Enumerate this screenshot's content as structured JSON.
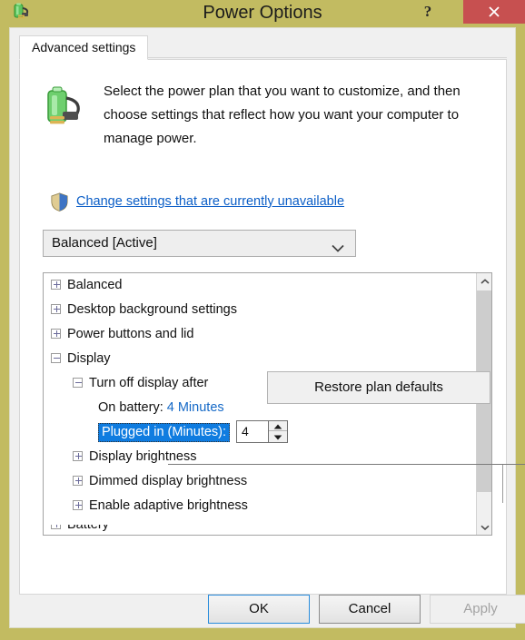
{
  "window": {
    "title": "Power Options",
    "icon": "power-plug-battery-icon",
    "titlebar_color": "#c2bb61",
    "close_color": "#c75050",
    "help_label": "?",
    "close_label": "✕"
  },
  "tabs": [
    {
      "label": "Advanced settings",
      "selected": true
    }
  ],
  "intro": {
    "text": "Select the power plan that you want to customize, and then choose settings that reflect how you want your computer to manage power.",
    "icon": "power-plug-battery-icon"
  },
  "change_link": {
    "label": "Change settings that are currently unavailable",
    "icon": "uac-shield-icon",
    "color": "#0b5ec7"
  },
  "plan_select": {
    "value": "Balanced [Active]",
    "arrow_icon": "chevron-down-icon"
  },
  "tree": {
    "nodes": [
      {
        "label": "Balanced",
        "indent": 0,
        "state": "collapsed"
      },
      {
        "label": "Desktop background settings",
        "indent": 0,
        "state": "collapsed"
      },
      {
        "label": "Power buttons and lid",
        "indent": 0,
        "state": "collapsed"
      },
      {
        "label": "Display",
        "indent": 0,
        "state": "expanded"
      },
      {
        "label": "Turn off display after",
        "indent": 1,
        "state": "expanded"
      },
      {
        "label": "On battery:",
        "indent": 2,
        "state": "none",
        "value": "4 Minutes",
        "value_color": "#1569c7"
      },
      {
        "label": "Plugged in (Minutes):",
        "indent": 2,
        "state": "none",
        "selected": true,
        "spinner_value": "4"
      },
      {
        "label": "Display brightness",
        "indent": 1,
        "state": "collapsed"
      },
      {
        "label": "Dimmed display brightness",
        "indent": 1,
        "state": "collapsed"
      },
      {
        "label": "Enable adaptive brightness",
        "indent": 1,
        "state": "collapsed"
      }
    ],
    "clipped_node": {
      "label": "Battery",
      "indent": 0,
      "state": "collapsed"
    },
    "selection_color": "#0f7ce0"
  },
  "scrollbar": {
    "up_icon": "chevron-up-icon",
    "down_icon": "chevron-down-icon",
    "thumb_color": "#cdcdcd"
  },
  "restore_button": {
    "label": "Restore plan defaults"
  },
  "bottom_buttons": {
    "ok": {
      "label": "OK",
      "focused": true
    },
    "cancel": {
      "label": "Cancel",
      "focused": false
    },
    "apply": {
      "label": "Apply",
      "disabled": true
    }
  }
}
